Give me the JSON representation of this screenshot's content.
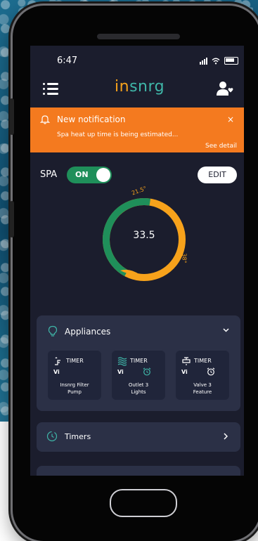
{
  "status_bar": {
    "time": "6:47"
  },
  "brand": {
    "logo_part1": "in",
    "logo_part2": "snrg"
  },
  "notification": {
    "title": "New notification",
    "message": "Spa heat up time is being estimated...",
    "link": "See detail",
    "close": "×"
  },
  "spa": {
    "label": "SPA",
    "toggle_state": "ON",
    "edit_label": "EDIT"
  },
  "gauge": {
    "current": "33.5",
    "min": "21.5°",
    "max": "38°",
    "fill_fraction": 0.72
  },
  "appliances": {
    "title": "Appliances",
    "items": [
      {
        "type": "TIMER",
        "badge": "Vi",
        "name_line1": "Insnrg Filter",
        "name_line2": "Pump",
        "icon": "pump-icon",
        "has_clock": false
      },
      {
        "type": "TIMER",
        "badge": "Vi",
        "name_line1": "Outlet 3",
        "name_line2": "Lights",
        "icon": "waves-icon",
        "has_clock": true
      },
      {
        "type": "TIMER",
        "badge": "Vi",
        "name_line1": "Valve 3",
        "name_line2": "Feature",
        "icon": "valve-icon",
        "has_clock": true
      }
    ]
  },
  "timers": {
    "title": "Timers"
  },
  "colors": {
    "accent_orange": "#f47a1f",
    "accent_amber": "#f7a21b",
    "accent_green": "#1f8f5a",
    "accent_teal": "#3fb6a8",
    "screen_bg": "#1b1d2d",
    "card_bg": "#2b3046"
  }
}
